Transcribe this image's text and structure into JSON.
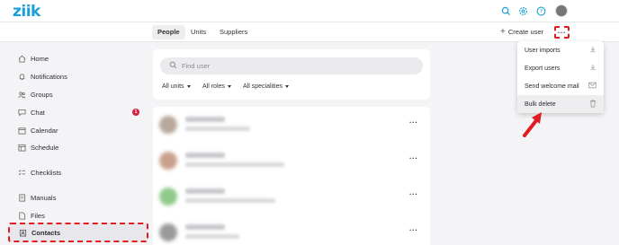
{
  "app": {
    "logo": "ziik"
  },
  "tabs": [
    {
      "label": "People",
      "active": true
    },
    {
      "label": "Units",
      "active": false
    },
    {
      "label": "Suppliers",
      "active": false
    }
  ],
  "header_actions": {
    "create_user": "Create user",
    "more": "···"
  },
  "sidebar": {
    "items": [
      {
        "label": "Home",
        "icon": "home-icon"
      },
      {
        "label": "Notifications",
        "icon": "bell-icon"
      },
      {
        "label": "Groups",
        "icon": "groups-icon"
      },
      {
        "label": "Chat",
        "icon": "chat-icon",
        "badge": "1"
      },
      {
        "label": "Calendar",
        "icon": "calendar-icon"
      },
      {
        "label": "Schedule",
        "icon": "schedule-icon"
      },
      {
        "label": "Checklists",
        "icon": "checklist-icon"
      },
      {
        "label": "Manuals",
        "icon": "manual-icon"
      },
      {
        "label": "Files",
        "icon": "files-icon"
      },
      {
        "label": "Contacts",
        "icon": "contacts-icon",
        "active": true
      }
    ]
  },
  "search": {
    "placeholder": "Find user"
  },
  "filters": [
    "All units",
    "All roles",
    "All specialities"
  ],
  "people": [
    {
      "avatar_color": "#b9a89c",
      "subtitle_width": 0.36
    },
    {
      "avatar_color": "#c9a08c",
      "subtitle_width": 0.55
    },
    {
      "avatar_color": "#8fca8a",
      "subtitle_width": 0.5
    },
    {
      "avatar_color": "#9a9a9a",
      "subtitle_width": 0.3
    }
  ],
  "row_menu": "···",
  "dropdown": {
    "items": [
      {
        "label": "User imports",
        "icon": "download-icon"
      },
      {
        "label": "Export users",
        "icon": "download-icon"
      },
      {
        "label": "Send welcome mail",
        "icon": "mail-icon"
      },
      {
        "label": "Bulk delete",
        "icon": "trash-icon",
        "highlighted": true
      }
    ]
  },
  "colors": {
    "accent": "#1aa0d8",
    "highlight": "#e01b22",
    "badge": "#d4213d"
  }
}
